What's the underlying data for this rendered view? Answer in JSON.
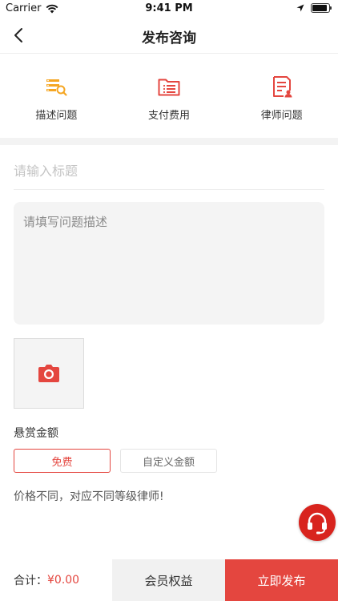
{
  "status_bar": {
    "carrier": "Carrier",
    "time": "9:41 PM"
  },
  "nav": {
    "title": "发布咨询"
  },
  "steps": [
    {
      "label": "描述问题",
      "icon": "search-list-icon",
      "color": "#f5a623"
    },
    {
      "label": "支付费用",
      "icon": "folder-list-icon",
      "color": "#e4463f"
    },
    {
      "label": "律师问题",
      "icon": "document-user-icon",
      "color": "#e4463f"
    }
  ],
  "form": {
    "title_placeholder": "请输入标题",
    "title_value": "",
    "desc_placeholder": "请填写问题描述",
    "desc_value": ""
  },
  "reward": {
    "label": "悬赏金额",
    "options": [
      "免费",
      "自定义金额"
    ],
    "selected": "免费",
    "hint": "价格不同，对应不同等级律师!"
  },
  "bottom": {
    "total_label": "合计：",
    "total_amount": "¥0.00",
    "member_label": "会员权益",
    "publish_label": "立即发布"
  },
  "colors": {
    "accent": "#e4463f",
    "step1": "#f5a623",
    "support": "#d8241e"
  }
}
